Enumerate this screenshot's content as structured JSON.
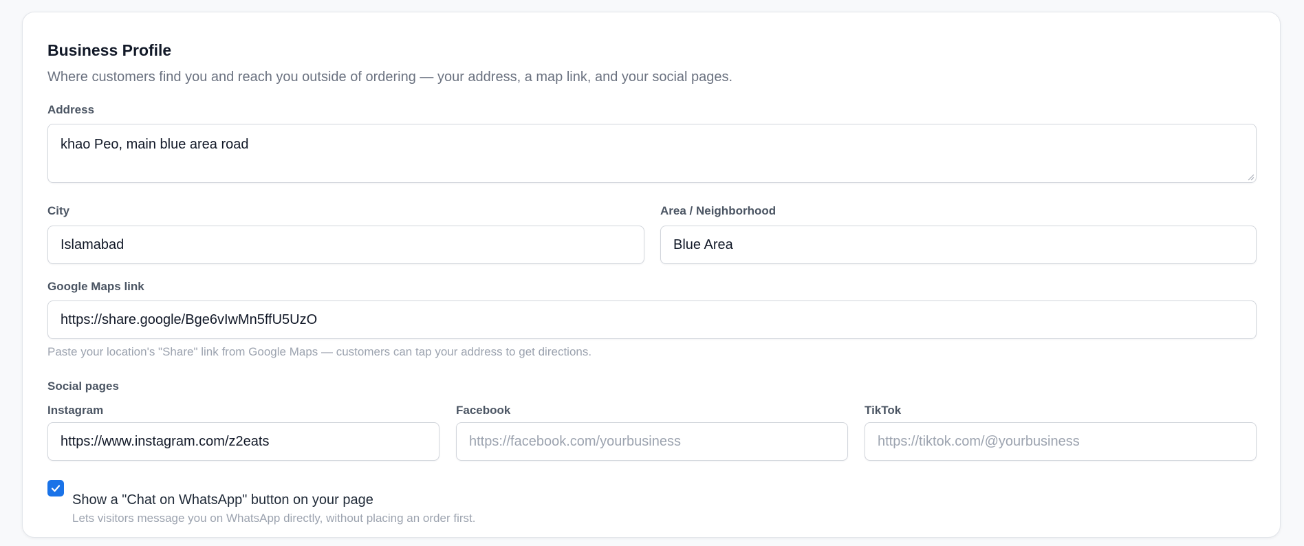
{
  "section": {
    "title": "Business Profile",
    "description": "Where customers find you and reach you outside of ordering — your address, a map link, and your social pages."
  },
  "address": {
    "label": "Address",
    "value": "khao Peo, main blue area road"
  },
  "city": {
    "label": "City",
    "value": "Islamabad"
  },
  "area": {
    "label": "Area / Neighborhood",
    "value": "Blue Area"
  },
  "maps": {
    "label": "Google Maps link",
    "value": "https://share.google/Bge6vIwMn5ffU5UzO",
    "hint": "Paste your location's \"Share\" link from Google Maps — customers can tap your address to get directions."
  },
  "social": {
    "heading": "Social pages",
    "instagram": {
      "label": "Instagram",
      "value": "https://www.instagram.com/z2eats"
    },
    "facebook": {
      "label": "Facebook",
      "placeholder": "https://facebook.com/yourbusiness"
    },
    "tiktok": {
      "label": "TikTok",
      "placeholder": "https://tiktok.com/@yourbusiness"
    }
  },
  "whatsapp": {
    "checked": true,
    "label": "Show a \"Chat on WhatsApp\" button on your page",
    "hint": "Lets visitors message you on WhatsApp directly, without placing an order first."
  },
  "colors": {
    "accent": "#1a73e8",
    "text": "#111827",
    "muted": "#6b7280",
    "placeholder": "#9ca3af",
    "border": "#d1d5db"
  }
}
